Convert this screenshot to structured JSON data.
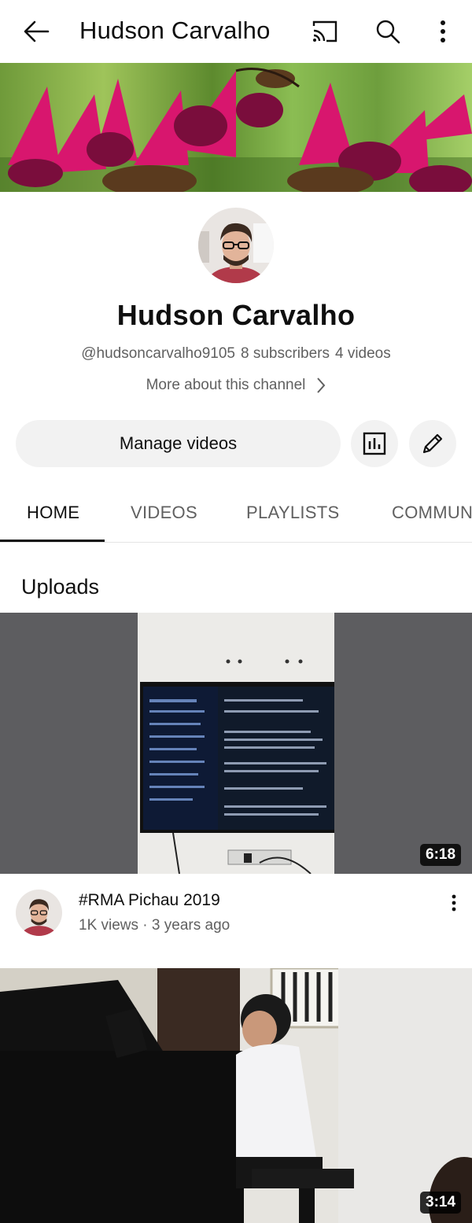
{
  "topbar": {
    "title": "Hudson Carvalho",
    "icons": [
      "back-arrow-icon",
      "cast-icon",
      "search-icon",
      "more-vert-icon"
    ]
  },
  "channel": {
    "name": "Hudson Carvalho",
    "handle": "@hudsoncarvalho9105",
    "subscribers": "8 subscribers",
    "videos": "4 videos",
    "about_link": "More about this channel",
    "manage_label": "Manage videos"
  },
  "tabs": [
    {
      "label": "HOME",
      "active": true
    },
    {
      "label": "VIDEOS",
      "active": false
    },
    {
      "label": "PLAYLISTS",
      "active": false
    },
    {
      "label": "COMMUN",
      "active": false
    }
  ],
  "uploads": {
    "title": "Uploads",
    "videos": [
      {
        "title": "#RMA Pichau 2019",
        "meta": "1K views · 3 years ago",
        "duration": "6:18"
      },
      {
        "duration": "3:14"
      }
    ]
  },
  "colors": {
    "text_primary": "#0f0f0f",
    "text_secondary": "#606060",
    "button_bg": "#f2f2f2"
  }
}
